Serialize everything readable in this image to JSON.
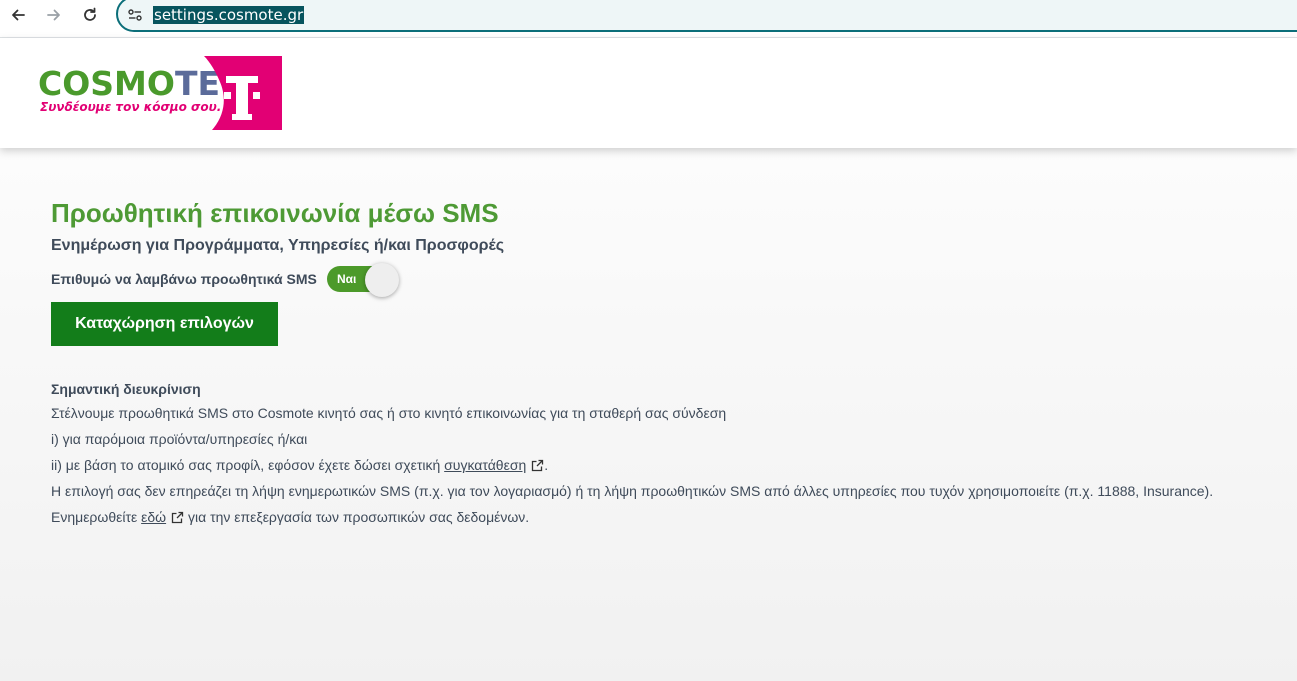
{
  "browser": {
    "url": "settings.cosmote.gr",
    "icons": [
      "back-arrow-icon",
      "forward-arrow-icon",
      "reload-icon",
      "site-info-icon"
    ]
  },
  "header": {
    "logo_word_a": "COSMO",
    "logo_word_b": "TE",
    "logo_tagline": "Συνδέουμε τον κόσμο σου.",
    "brand_colors": {
      "green": "#4a9a2c",
      "magenta": "#e20074"
    }
  },
  "main": {
    "title": "Προωθητική επικοινωνία μέσω SMS",
    "subtitle": "Ενημέρωση για Προγράμματα, Υπηρεσίες ή/και Προσφορές",
    "preference_label": "Επιθυμώ να λαμβάνω προωθητικά SMS",
    "toggle": {
      "label": "Ναι",
      "checked": true
    },
    "submit_label": "Καταχώρηση επιλογών",
    "accent_color": "#137d1a"
  },
  "note": {
    "title": "Σημαντική διευκρίνιση",
    "line1": "Στέλνουμε προωθητικά SMS στο Cosmote κινητό σας ή στο κινητό επικοινωνίας για τη σταθερή σας σύνδεση",
    "line2": "i) για παρόμοια προϊόντα/υπηρεσίες ή/και",
    "line3_prefix": "ii) με βάση το ατομικό σας προφίλ, εφόσον έχετε δώσει σχετική ",
    "line3_link": "συγκατάθεση",
    "line3_suffix": ".",
    "line4": "Η επιλογή σας δεν επηρεάζει τη λήψη ενημερωτικών SMS (π.χ. για τον λογαριασμό) ή τη λήψη προωθητικών SMS από άλλες υπηρεσίες που τυχόν χρησιμοποιείτε (π.χ. 11888, Insurance).",
    "line5_prefix": "Ενημερωθείτε ",
    "line5_link": "εδώ",
    "line5_suffix": " για την επεξεργασία των προσωπικών σας δεδομένων."
  }
}
